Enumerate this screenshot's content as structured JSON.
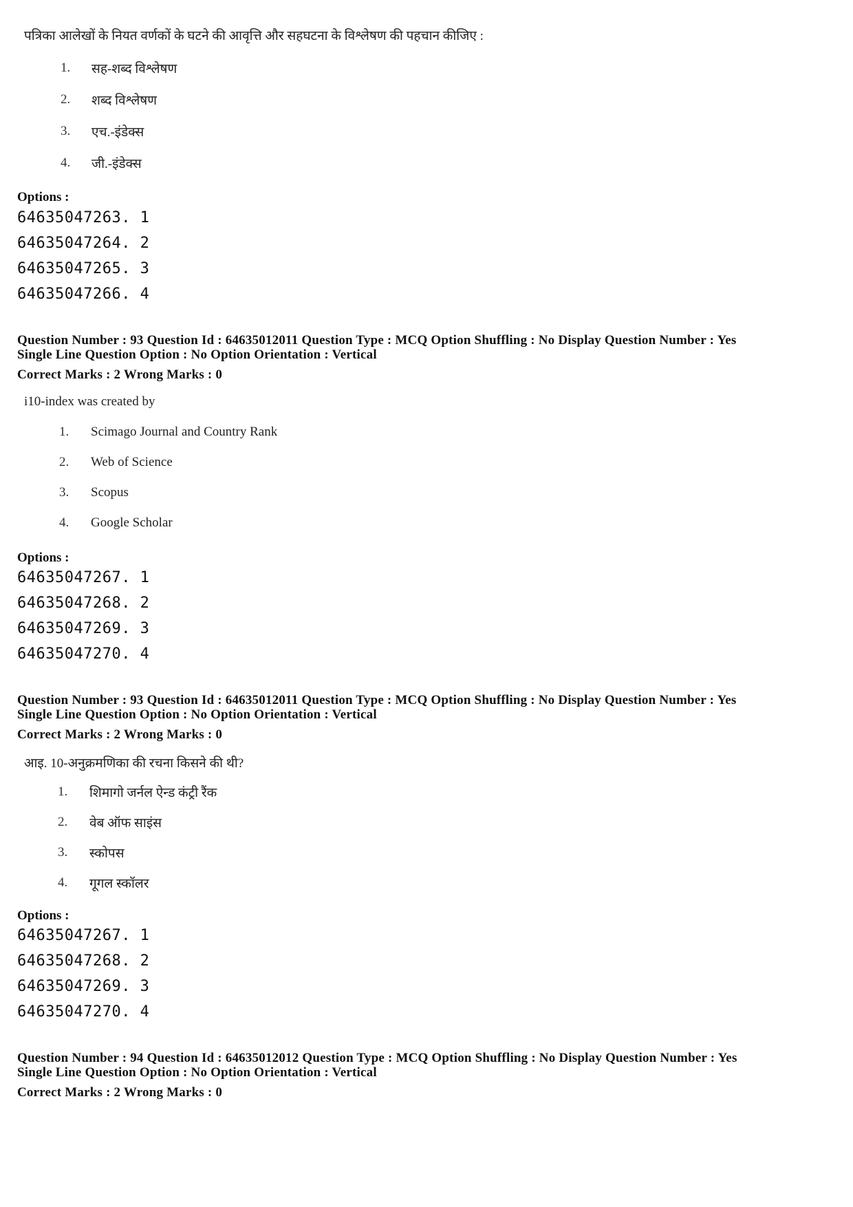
{
  "blocks": [
    {
      "question_text": "पत्रिका आलेखों के नियत वर्णकों के घटने की आवृत्ति और सहघटना के विश्लेषण की पहचान कीजिए :",
      "items": [
        {
          "num": "1.",
          "text": "सह-शब्द विश्लेषण"
        },
        {
          "num": "2.",
          "text": "शब्द विश्लेषण"
        },
        {
          "num": "3.",
          "text": "एच.-इंडेक्स"
        },
        {
          "num": "4.",
          "text": "जी.-इंडेक्स"
        }
      ],
      "options_label": "Options :",
      "options": [
        "64635047263. 1",
        "64635047264. 2",
        "64635047265. 3",
        "64635047266. 4"
      ]
    },
    {
      "meta_line1": "Question Number : 93  Question Id : 64635012011  Question Type : MCQ  Option Shuffling : No  Display Question Number : Yes",
      "meta_line2": "Single Line Question Option : No  Option Orientation : Vertical",
      "meta_line3": "Correct Marks : 2  Wrong Marks : 0",
      "question_text": "i10-index was created by",
      "items": [
        {
          "num": "1.",
          "text": "Scimago Journal and Country Rank"
        },
        {
          "num": "2.",
          "text": "Web of Science"
        },
        {
          "num": "3.",
          "text": "Scopus"
        },
        {
          "num": "4.",
          "text": "Google Scholar"
        }
      ],
      "options_label": "Options :",
      "options": [
        "64635047267. 1",
        "64635047268. 2",
        "64635047269. 3",
        "64635047270. 4"
      ]
    },
    {
      "meta_line1": "Question Number : 93  Question Id : 64635012011  Question Type : MCQ  Option Shuffling : No  Display Question Number : Yes",
      "meta_line2": "Single Line Question Option : No  Option Orientation : Vertical",
      "meta_line3": "Correct Marks : 2  Wrong Marks : 0",
      "question_text": "आइ. 10-अनुक्रमणिका की रचना किसने की थी?",
      "items": [
        {
          "num": "1.",
          "text": "शिमागो जर्नल ऐन्ड कंट्री रैंक"
        },
        {
          "num": "2.",
          "text": "वेब ऑफ साइंस"
        },
        {
          "num": "3.",
          "text": "स्कोपस"
        },
        {
          "num": "4.",
          "text": "गूगल स्कॉलर"
        }
      ],
      "options_label": "Options :",
      "options": [
        "64635047267. 1",
        "64635047268. 2",
        "64635047269. 3",
        "64635047270. 4"
      ]
    },
    {
      "meta_line1": "Question Number : 94  Question Id : 64635012012  Question Type : MCQ  Option Shuffling : No  Display Question Number : Yes",
      "meta_line2": "Single Line Question Option : No  Option Orientation : Vertical",
      "meta_line3": "Correct Marks : 2  Wrong Marks : 0"
    }
  ]
}
